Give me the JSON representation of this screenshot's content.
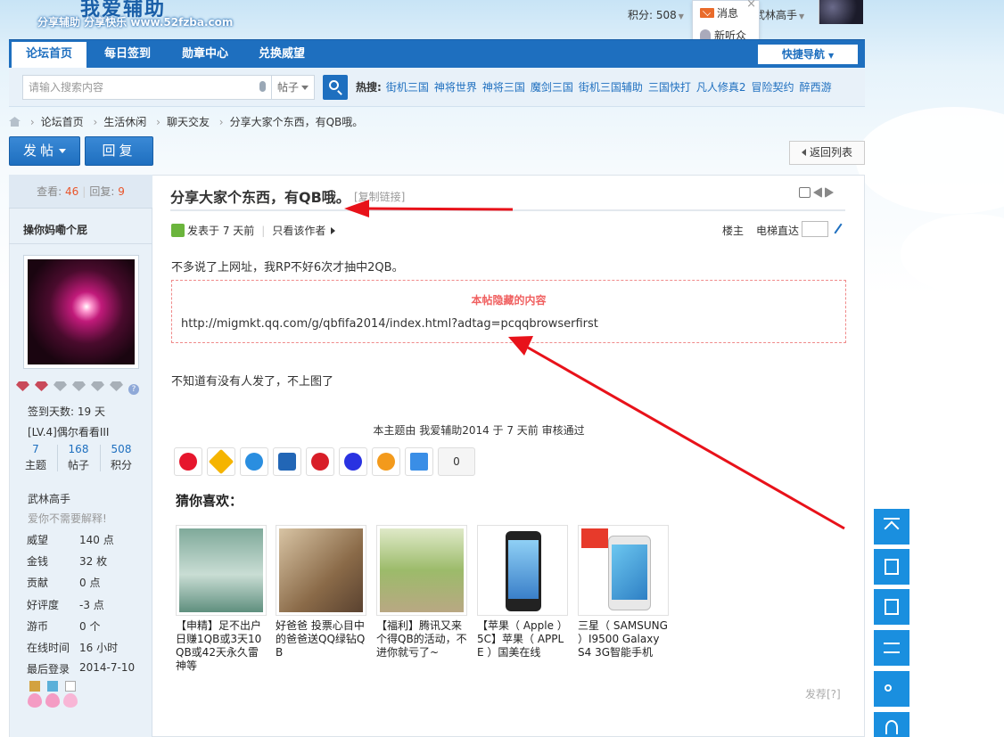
{
  "header": {
    "logo_text": "我爱辅助",
    "logo_sub": "分享辅助   分享快乐  www.52fzba.com",
    "score_label": "积分: 508",
    "username": "武林高手",
    "msg_label": "消息",
    "listener_label": "新听众"
  },
  "nav": {
    "tabs": [
      "论坛首页",
      "每日签到",
      "勋章中心",
      "兑换威望"
    ],
    "quick_nav": "快捷导航"
  },
  "search": {
    "placeholder": "请输入搜索内容",
    "type": "帖子",
    "hot_label": "热搜:",
    "hot_keywords": [
      "街机三国",
      "神将世界",
      "神将三国",
      "魔剑三国",
      "街机三国辅助",
      "三国快打",
      "凡人修真2",
      "冒险契约",
      "醉西游"
    ]
  },
  "breadcrumb": [
    "论坛首页",
    "生活休闲",
    "聊天交友",
    "分享大家个东西，有QB哦。"
  ],
  "actions": {
    "post": "发帖",
    "reply": "回复",
    "back": "返回列表"
  },
  "sidebar": {
    "views_label": "查看:",
    "views": "46",
    "replies_label": "回复:",
    "replies": "9",
    "author": "操你妈嘞个屁",
    "signin_days": "签到天数: 19 天",
    "level": "[LV.4]偶尔看看III",
    "stats": [
      {
        "n": "7",
        "l": "主题"
      },
      {
        "n": "168",
        "l": "帖子"
      },
      {
        "n": "508",
        "l": "积分"
      }
    ],
    "group_name": "武林高手",
    "motto": "爱你不需要解释!",
    "attrs": [
      {
        "k": "威望",
        "v": "140 点"
      },
      {
        "k": "金钱",
        "v": "32 枚"
      },
      {
        "k": "贡献",
        "v": "0 点"
      },
      {
        "k": "好评度",
        "v": "-3 点"
      },
      {
        "k": "游币",
        "v": "0 个"
      },
      {
        "k": "在线时间",
        "v": "16 小时"
      },
      {
        "k": "最后登录",
        "v": "2014-7-10"
      }
    ]
  },
  "post": {
    "title": "分享大家个东西，有QB哦。",
    "copy_link": "[复制链接]",
    "posted_time": "发表于 7 天前",
    "only_author": "只看该作者",
    "floor": "楼主",
    "jump": "电梯直达",
    "line1": "不多说了上网址，我RP不好6次才抽中2QB。",
    "hidden_title": "本帖隐藏的内容",
    "hidden_url": "http://migmkt.qq.com/g/qbfifa2014/index.html?adtag=pcqqbrowserfirst",
    "line2": "不知道有没有人发了，不上图了",
    "audit": "本主题由 我爱辅助2014 于 7 天前 审核通过",
    "share_count": "0",
    "guess_title": "猜你喜欢：",
    "report": "发荐[?]"
  },
  "recommend": [
    {
      "caption": "【申精】足不出户日赚1QB或3天10QB或42天永久雷神等"
    },
    {
      "caption": "好爸爸 投票心目中的爸爸送QQ绿钻QB"
    },
    {
      "caption": "【福利】腾讯又来个得QB的活动，不进你就亏了~"
    },
    {
      "caption": "【苹果（ Apple ）5C】苹果（ APPLE ）国美在线"
    },
    {
      "caption": "三星（ SAMSUNG ）I9500 Galaxy S4 3G智能手机"
    }
  ],
  "colors": {
    "nav_blue": "#1e6fbf",
    "float_blue": "#1a8fdf",
    "hidden_red": "#f06060",
    "arrow_red": "#e8121a"
  }
}
